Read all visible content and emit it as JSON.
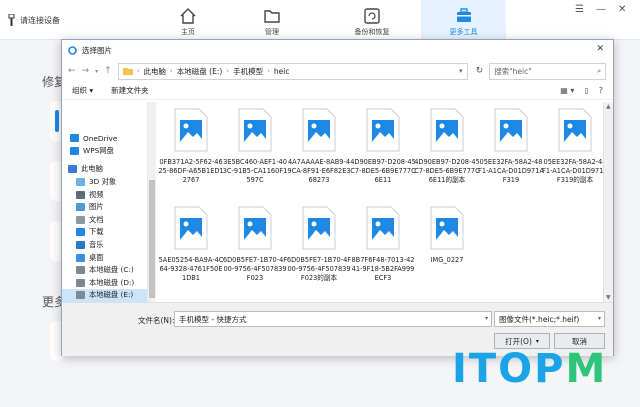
{
  "app": {
    "connect_label": "请连接设备",
    "tabs": [
      {
        "label": "主页",
        "icon": "home-icon"
      },
      {
        "label": "管理",
        "icon": "folder-icon"
      },
      {
        "label": "备份和恢复",
        "icon": "backup-restore-icon"
      },
      {
        "label": "更多工具",
        "icon": "toolbox-icon",
        "active": true
      }
    ],
    "bg_fragment_1": "修复",
    "bg_fragment_2": "更多",
    "accent": "#1e88e5"
  },
  "dialog": {
    "title": "选择图片",
    "close_glyph": "✕",
    "breadcrumbs": [
      "此电脑",
      "本地磁盘 (E:)",
      "手机模型",
      "heic"
    ],
    "search_placeholder": "搜索\"heic\"",
    "organize_label": "组织 ▾",
    "new_folder_label": "新建文件夹",
    "tree": [
      {
        "label": "OneDrive",
        "icon": "cloud-icon"
      },
      {
        "label": "WPS网盘",
        "icon": "cloud-icon"
      },
      {
        "label": "此电脑",
        "icon": "computer-icon"
      },
      {
        "label": "3D 对象",
        "icon": "3d-objects-icon"
      },
      {
        "label": "视频",
        "icon": "video-folder-icon"
      },
      {
        "label": "图片",
        "icon": "pictures-folder-icon"
      },
      {
        "label": "文档",
        "icon": "documents-folder-icon"
      },
      {
        "label": "下载",
        "icon": "downloads-folder-icon"
      },
      {
        "label": "音乐",
        "icon": "music-folder-icon"
      },
      {
        "label": "桌面",
        "icon": "desktop-folder-icon"
      },
      {
        "label": "本地磁盘 (C:)",
        "icon": "drive-icon"
      },
      {
        "label": "本地磁盘 (D:)",
        "icon": "drive-icon"
      },
      {
        "label": "本地磁盘 (E:)",
        "icon": "drive-icon",
        "selected": true
      }
    ],
    "files": [
      "0FB371A2-5F62-4625-86DF-A65B1ED12767",
      "3E5BC460-AEF1-403C-91B5-CA1160F1597C",
      "4A7AAAAE-8AB9-49CA-8F91-E6F82E368273",
      "4D90EB97-D208-45C7-8DE5-6B9E777C6E11",
      "4D90EB97-D208-45C7-8DE5-6B9E777C6E11的副本",
      "05EE32FA-58A2-48F1-A1CA-D01D971AF319",
      "05EE32FA-58A2-48F1-A1CA-D01D971AF319的副本",
      "5AE05254-BA9A-4C64-9328-4761F50E1DB1",
      "6D0B5FE7-1B70-4F00-9756-4F507839F023",
      "6D0B5FE7-1B70-4F00-9756-4F507839F023的副本",
      "8B7F6F48-7013-4241-9F18-5B2FA999ECF3",
      "IMG_0227"
    ],
    "filename_label": "文件名(N):",
    "filename_value": "手机模型 - 快捷方式",
    "filetype_value": "图像文件(*.heic;*.heif)",
    "open_label": "打开(O)",
    "cancel_label": "取消"
  },
  "watermark": {
    "part1": "ITOP",
    "part2": "M"
  }
}
